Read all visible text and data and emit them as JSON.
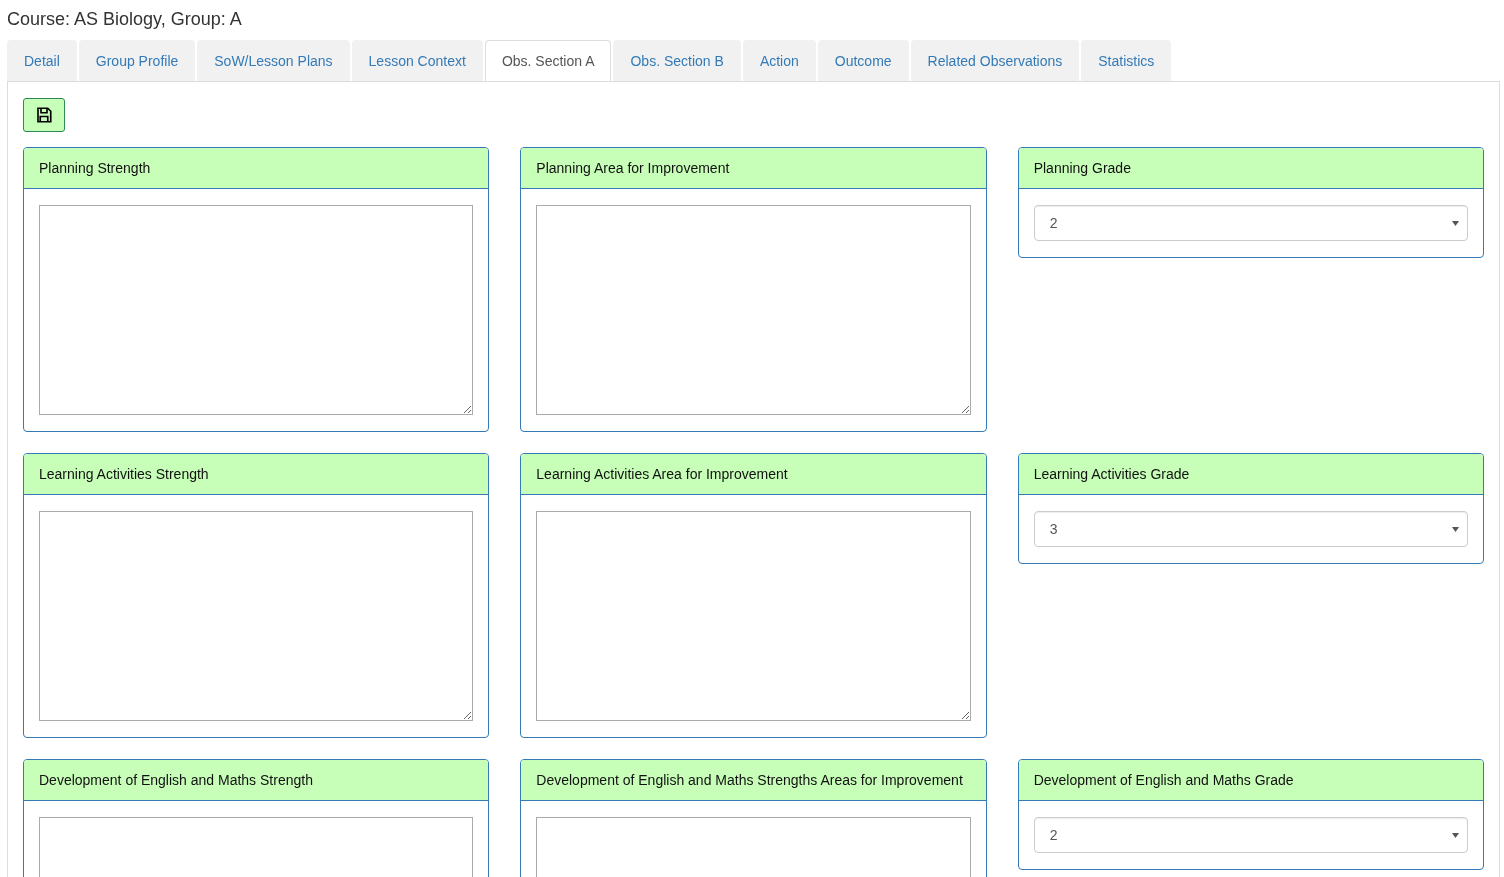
{
  "heading": "Course: AS Biology, Group: A",
  "tabs": [
    {
      "label": "Detail",
      "selected": false
    },
    {
      "label": "Group Profile",
      "selected": false
    },
    {
      "label": "SoW/Lesson Plans",
      "selected": false
    },
    {
      "label": "Lesson Context",
      "selected": false
    },
    {
      "label": "Obs. Section A",
      "selected": true
    },
    {
      "label": "Obs. Section B",
      "selected": false
    },
    {
      "label": "Action",
      "selected": false
    },
    {
      "label": "Outcome",
      "selected": false
    },
    {
      "label": "Related Observations",
      "selected": false
    },
    {
      "label": "Statistics",
      "selected": false
    }
  ],
  "rows": [
    {
      "panels": [
        {
          "kind": "text",
          "title": "Planning Strength"
        },
        {
          "kind": "text",
          "title": "Planning Area for Improvement"
        },
        {
          "kind": "grade",
          "title": "Planning Grade",
          "value": "2"
        }
      ]
    },
    {
      "panels": [
        {
          "kind": "text",
          "title": "Learning Activities Strength"
        },
        {
          "kind": "text",
          "title": "Learning Activities Area for Improvement"
        },
        {
          "kind": "grade",
          "title": "Learning Activities Grade",
          "value": "3"
        }
      ]
    },
    {
      "panels": [
        {
          "kind": "text",
          "title": "Development of English and Maths Strength"
        },
        {
          "kind": "text",
          "title": "Development of English and Maths Strengths Areas for Improvement"
        },
        {
          "kind": "grade",
          "title": "Development of English and Maths Grade",
          "value": "2"
        }
      ]
    }
  ]
}
